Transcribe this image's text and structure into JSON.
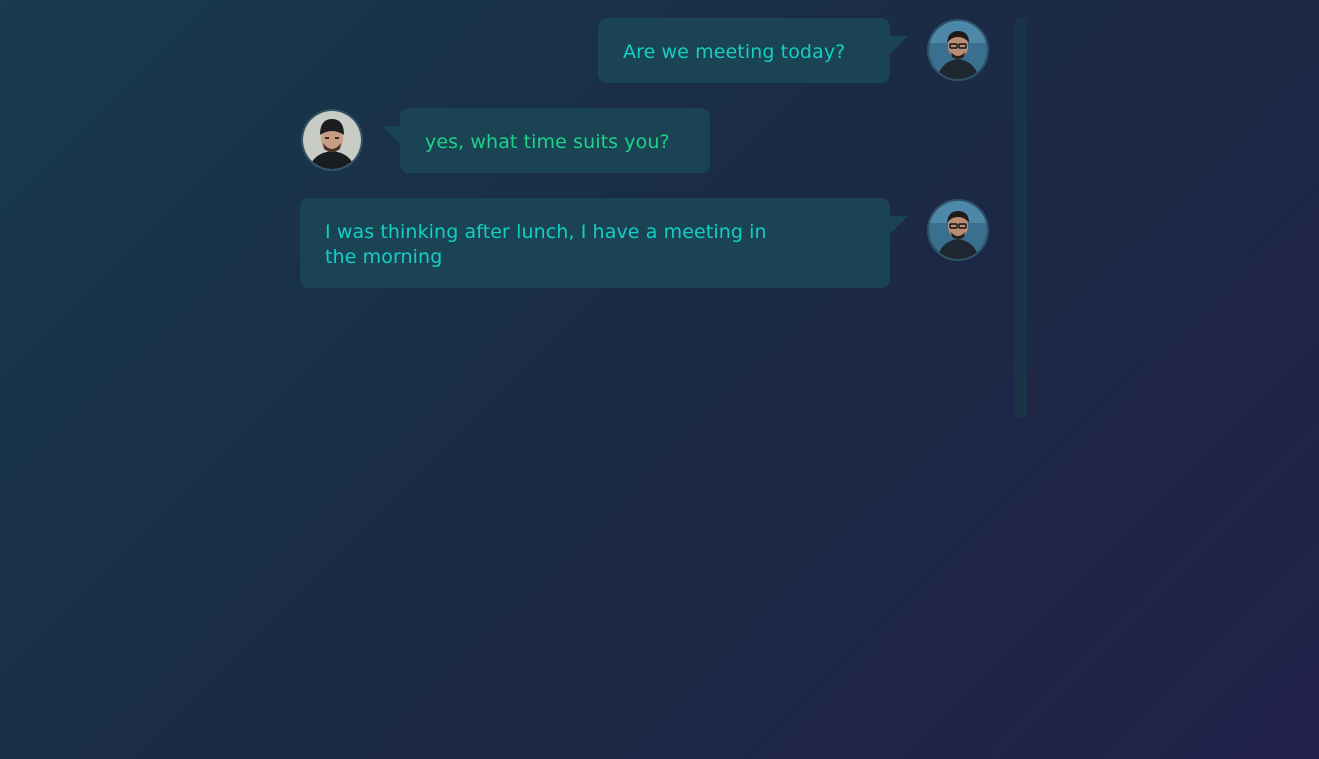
{
  "conversation": {
    "messages": [
      {
        "sender": "me",
        "text": "Are we meeting today?",
        "avatar": "man-with-glasses-avatar"
      },
      {
        "sender": "other",
        "text": "yes, what time suits you?",
        "avatar": "man-with-beanie-avatar"
      },
      {
        "sender": "me",
        "text": "I was thinking after lunch, I have a meeting in the morning",
        "avatar": "man-with-glasses-avatar"
      }
    ]
  },
  "colors": {
    "background_start": "#183b4d",
    "background_end": "#23224a",
    "bubble": "#1a4354",
    "text_me": "#13cfc4",
    "text_other": "#1dd38b",
    "scrollbar_track": "#1a3447"
  }
}
